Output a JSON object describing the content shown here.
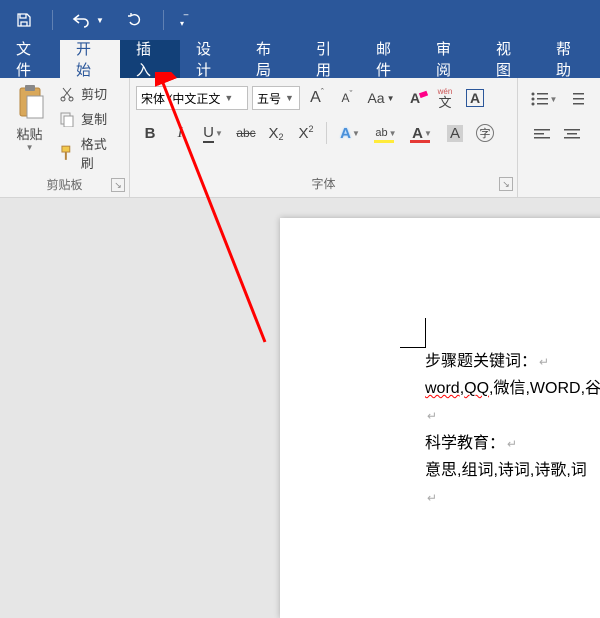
{
  "titlebar": {
    "save": "save",
    "undo": "undo",
    "redo": "redo",
    "customize": "customize"
  },
  "menu": {
    "file": "文件",
    "home": "开始",
    "insert": "插入",
    "design": "设计",
    "layout": "布局",
    "references": "引用",
    "mailings": "邮件",
    "review": "审阅",
    "view": "视图",
    "help": "帮助"
  },
  "ribbon": {
    "clipboard": {
      "label": "剪贴板",
      "paste": "粘贴",
      "cut": "剪切",
      "copy": "复制",
      "format_painter": "格式刷"
    },
    "font": {
      "label": "字体",
      "name": "宋体 (中文正文",
      "size": "五号",
      "grow": "A",
      "shrink": "A",
      "case": "Aa",
      "clear": "A",
      "phonetic": "wén",
      "charborder": "A",
      "bold": "B",
      "italic": "I",
      "underline": "U",
      "strike": "abc",
      "sub": "X",
      "sup": "X",
      "effects": "A",
      "highlight": "ab",
      "color": "A",
      "shading": "A",
      "enclose": "字"
    },
    "paragraph": {
      "label": ""
    }
  },
  "doc": {
    "line1": "步骤题关键词：",
    "line2a": "word",
    "line2b": ",",
    "line2c": "QQ",
    "line2d": ",微信,WORD,谷",
    "line3": "科学教育：",
    "line4": "意思,组词,诗词,诗歌,词"
  }
}
